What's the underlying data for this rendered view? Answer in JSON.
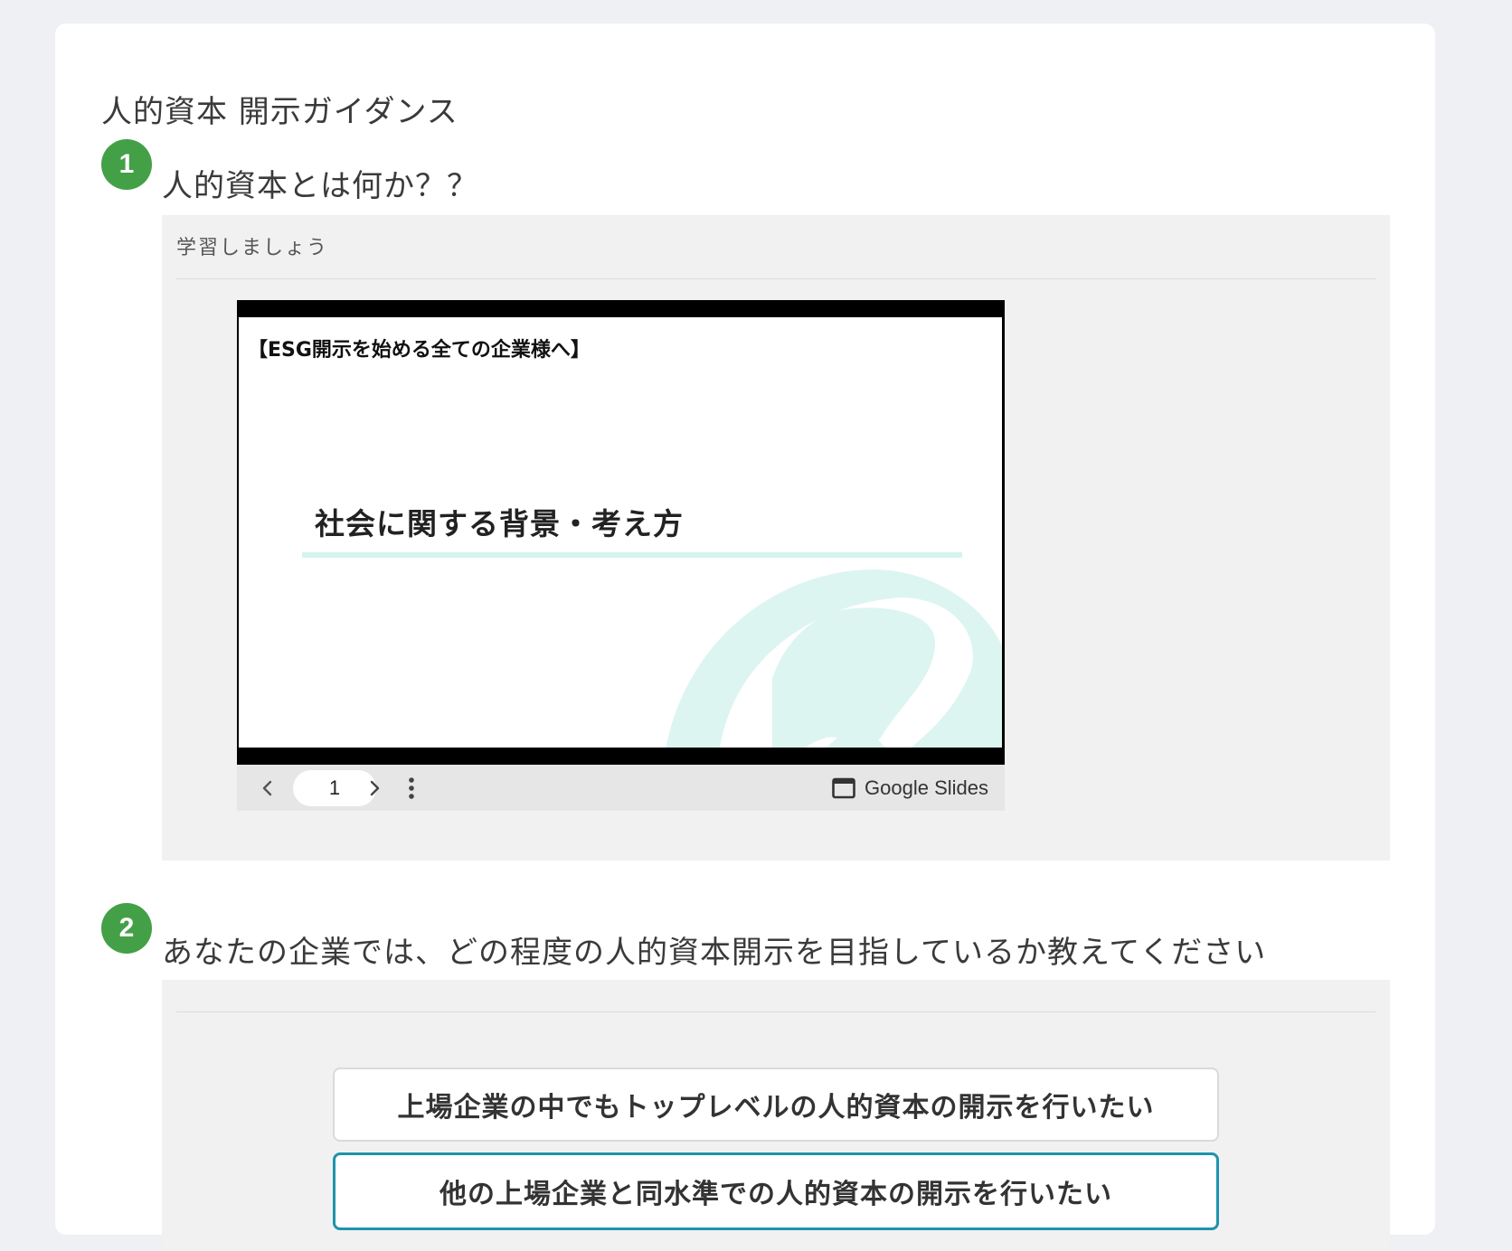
{
  "page": {
    "title": "人的資本 開示ガイダンス"
  },
  "step1": {
    "number": "1",
    "title": "人的資本とは何か？？",
    "panel_label": "学習しましょう",
    "slides": {
      "header": "【ESG開示を始める全ての企業様へ】",
      "slide_title": "社会に関する背景・考え方",
      "page_number": "1",
      "brand_label": "Google Slides",
      "icons": {
        "prev": "chevron-left-icon",
        "next": "chevron-right-icon",
        "more": "more-vertical-icon",
        "brand": "slides-logo-icon"
      }
    }
  },
  "step2": {
    "number": "2",
    "title": "あなたの企業では、どの程度の人的資本開示を目指しているか教えてください",
    "options": [
      {
        "label": "上場企業の中でもトップレベルの人的資本の開示を行いたい",
        "selected": false
      },
      {
        "label": "他の上場企業と同水準での人的資本の開示を行いたい",
        "selected": true
      }
    ]
  },
  "colors": {
    "accent_green": "#43a047",
    "selected_border": "#1e93ad",
    "panel_bg": "#f1f1f1",
    "page_bg": "#eff0f3"
  }
}
